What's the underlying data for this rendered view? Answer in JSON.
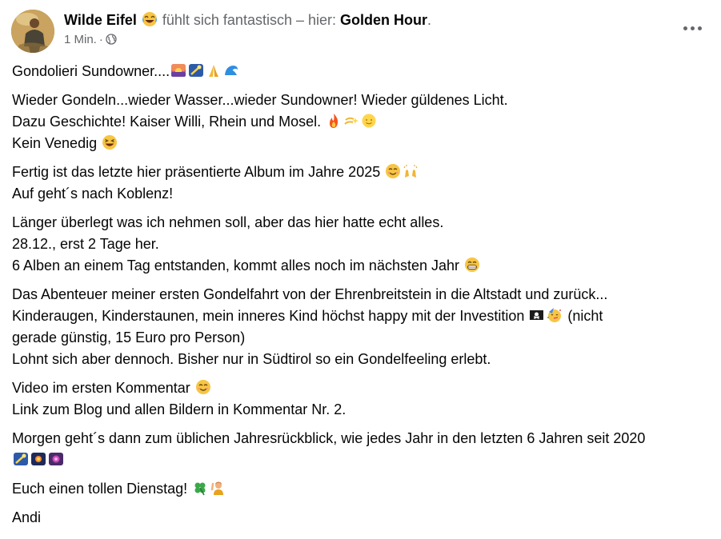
{
  "post": {
    "author": "Wilde Eifel",
    "feeling_emoji": "laughing-face",
    "feeling_text": "fühlt sich fantastisch – hier:",
    "place": "Golden Hour",
    "place_suffix": ".",
    "timestamp": "1 Min.",
    "separator": "·",
    "privacy_icon": "globe-icon",
    "more_icon": "three-dots-icon"
  },
  "body": {
    "title": "Gondolieri Sundowner....",
    "p1_l1": "Wieder Gondeln...wieder Wasser...wieder Sundowner! Wieder güldenes Licht.",
    "p1_l2": "Dazu Geschichte! Kaiser Willi, Rhein und Mosel.",
    "p1_l3": "Kein Venedig",
    "p2_l1": "Fertig ist das letzte hier präsentierte Album im Jahre 2025",
    "p2_l2": "Auf geht´s nach Koblenz!",
    "p3_l1": "Länger überlegt was ich nehmen soll, aber das hier hatte echt alles.",
    "p3_l2": "28.12., erst 2 Tage her.",
    "p3_l3": "6 Alben an einem Tag entstanden, kommt alles noch im nächsten Jahr",
    "p4_l1": "Das Abenteuer meiner ersten Gondelfahrt von der Ehrenbreitstein in die Altstadt und zurück...",
    "p4_l2": "Kinderaugen, Kinderstaunen, mein inneres Kind höchst happy mit der Investition",
    "p4_l2b": "(nicht",
    "p4_l3": "gerade günstig, 15 Euro pro Person)",
    "p4_l4": "Lohnt sich aber dennoch. Bisher nur in Südtirol so ein Gondelfeeling erlebt.",
    "p5_l1": "Video im ersten Kommentar",
    "p5_l2": "Link zum Blog und allen Bildern in Kommentar Nr. 2.",
    "p6_l1": "Morgen geht´s dann zum üblichen Jahresrückblick, wie jedes Jahr in den letzten 6 Jahren seit 2020",
    "p7_l1": "Euch einen tollen Dienstag!",
    "signature": "Andi"
  },
  "colors": {
    "text": "#050505",
    "secondary": "#65676b"
  }
}
